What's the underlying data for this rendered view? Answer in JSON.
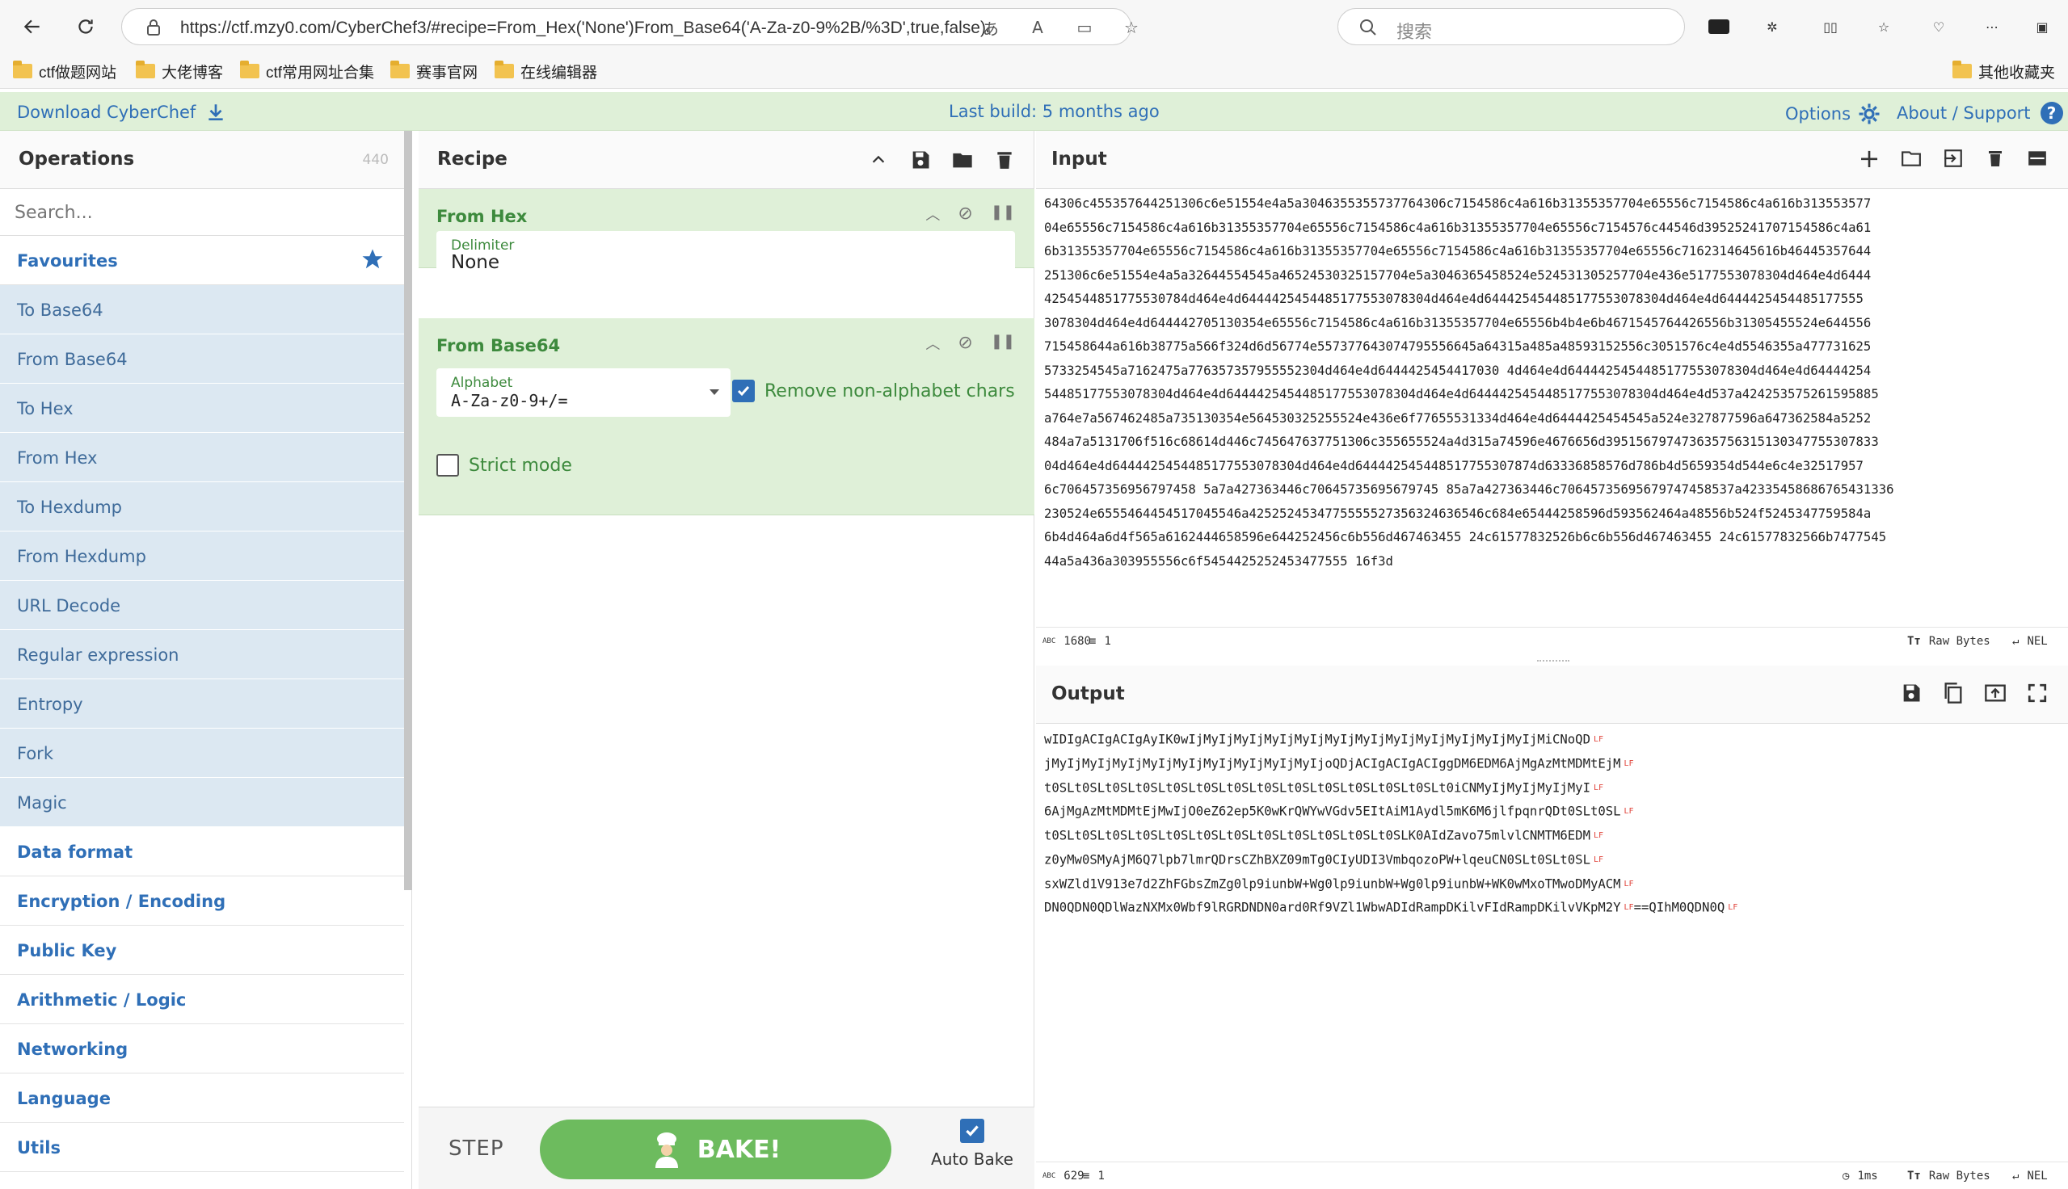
{
  "browser": {
    "url": "https://ctf.mzy0.com/CyberChef3/#recipe=From_Hex('None')From_Base64('A-Za-z0-9%2B/%3D',true,false)&input=NjQzMD...",
    "search_placeholder": "搜索",
    "bookmarks": [
      "ctf做题网站",
      "大佬博客",
      "ctf常用网址合集",
      "赛事官网",
      "在线编辑器"
    ],
    "other_bookmarks": "其他收藏夹"
  },
  "banner": {
    "download": "Download CyberChef",
    "last_build": "Last build: 5 months ago",
    "options": "Options",
    "about": "About / Support"
  },
  "operations": {
    "title": "Operations",
    "count": "440",
    "search_placeholder": "Search...",
    "favourites_label": "Favourites",
    "favourites": [
      "To Base64",
      "From Base64",
      "To Hex",
      "From Hex",
      "To Hexdump",
      "From Hexdump",
      "URL Decode",
      "Regular expression",
      "Entropy",
      "Fork",
      "Magic"
    ],
    "categories": [
      "Data format",
      "Encryption / Encoding",
      "Public Key",
      "Arithmetic / Logic",
      "Networking",
      "Language",
      "Utils"
    ]
  },
  "recipe": {
    "title": "Recipe",
    "ops": [
      {
        "name": "From Hex",
        "delimiter_label": "Delimiter",
        "delimiter_value": "None"
      },
      {
        "name": "From Base64",
        "alphabet_label": "Alphabet",
        "alphabet_value": "A-Za-z0-9+/=",
        "remove_label": "Remove non-alphabet chars",
        "remove_checked": true,
        "strict_label": "Strict mode",
        "strict_checked": false
      }
    ],
    "step_label": "STEP",
    "bake_label": "BAKE!",
    "autobake_label": "Auto Bake",
    "autobake_checked": true
  },
  "input": {
    "title": "Input",
    "lines": [
      "64306c455357644251306c6e51554e4a5a3046355355737764306c7154586c4a616b31355357704e65556c7154586c4a616b313553577",
      "04e65556c7154586c4a616b31355357704e65556c7154586c4a616b31355357704e65556c7154576c44546d39525241707154586c4a61",
      "6b31355357704e65556c7154586c4a616b31355357704e65556c7154586c4a616b31355357704e65556c7162314645616b46445357644",
      "251306c6e51554e4a5a32644554545a46524530325157704e5a3046365458524e524531305257704e436e5177553078304d464e4d6444",
      "4254544851775530784d464e4d6444425454485177553078304d464e4d644425454485177553078304d464e4d6444425454485177555",
      "3078304d464e4d644442705130354e65556c7154586c4a616b31355357704e65556b4b4e6b4671545764426556b31305455524e644556",
      "715458644a616b38775a566f324d6d56774e557377643074795556645a64315a485a48593152556c3051576c4e4d5546355a477731625",
      "5733254545a7162475a776357357955552304d464e4d6444425454417030 4d464e4d6444425454485177553078304d464e4d64444254",
      "54485177553078304d464e4d6444425454485177553078304d464e4d6444425454485177553078304d464e4d537a424253575261595885",
      "a764e7a567462485a735130354e564530325255524e436e6f77655531334d464e4d6444425454545a524e327877596a647362584a5252",
      "484a7a5131706f516c68614d446c745647637751306c355655524a4d315a74596e4676656d395156797473635756315130347755307833",
      "04d464e4d6444425454485177553078304d464e4d644442545448517755307874d63336858576d786b4d5659354d544e6c4e32517957",
      "6c706457356956797458 5a7a427363446c70645735695679745 85a7a427363446c70645735695679747458537a42335458686765431336",
      "230524e6555464454517045546a4252524534775555527356324636546c684e65444258596d593562464a48556b524f5245347759584a",
      "6b4d464a6d4f565a6162444658596e644252456c6b556d467463455 24c61577832526b6c6b556d467463455 24c61577832566b7477545",
      "44a5a436a303955556c6f5454425252453477555 16f3d"
    ],
    "status_chars": "1680",
    "status_lines": "1",
    "status_mode": "Raw Bytes",
    "status_eol": "NEL"
  },
  "output": {
    "title": "Output",
    "lines": [
      "wIDIgACIgACIgAyIK0wIjMyIjMyIjMyIjMyIjMyIjMyIjMyIjMyIjMyIjMyIjMyIjMiCNoQD",
      "jMyIjMyIjMyIjMyIjMyIjMyIjMyIjMyIjMyIjoQDjACIgACIgACIggDM6EDM6AjMgAzMtMDMtEjM",
      "t0SLt0SLt0SLt0SLt0SLt0SLt0SLt0SLt0SLt0SLt0SLt0SLt0SLt0iCNMyIjMyIjMyIjMyI",
      "6AjMgAzMtMDMtEjMwIjO0eZ62ep5K0wKrQWYwVGdv5EItAiM1Aydl5mK6M6jlfpqnrQDt0SLt0SL",
      "t0SLt0SLt0SLt0SLt0SLt0SLt0SLt0SLt0SLt0SLt0SLt0SLK0AIdZavo75mlvlCNMTM6EDM",
      "z0yMw0SMyAjM6Q7lpb7lmrQDrsCZhBXZ09mTg0CIyUDI3VmbqozoPW+lqeuCN0SLt0SLt0SL",
      "sxWZld1V913e7d2ZhFGbsZmZg0lp9iunbW+Wg0lp9iunbW+Wg0lp9iunbW+WK0wMxoTMwoDMyACM",
      "DN0QDN0QDlWazNXMx0Wbf9lRGRDNDN0ard0Rf9VZl1WbwADIdRampDKilvFIdRampDKilvVKpM2Y"
    ],
    "last_line_tail": "==QIhM0QDN0Q",
    "status_chars": "629",
    "status_lines": "1",
    "status_time": "1ms",
    "status_mode": "Raw Bytes",
    "status_eol": "NEL"
  },
  "colors": {
    "accent_blue": "#2f6fb7",
    "recipe_green": "#dff0d8",
    "bake_green": "#6dbb5e",
    "fav_blue": "#dce8f2"
  }
}
